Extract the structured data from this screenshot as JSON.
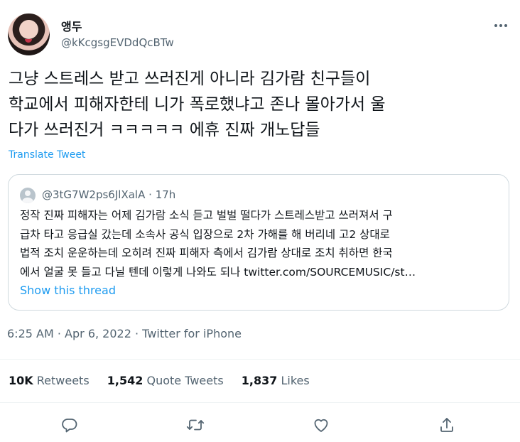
{
  "author": {
    "display_name": "앵두",
    "handle": "@kKcgsgEVDdQcBTw"
  },
  "tweet": {
    "lines": [
      "그냥 스트레스 받고 쓰러진게 아니라 김가람 친구들이",
      "학교에서 피해자한테 니가 폭로했냐고 존나 몰아가서 울",
      "다가 쓰러진거 ㅋㅋㅋㅋㅋ 에휴 진짜 개노답들"
    ],
    "translate_label": "Translate Tweet"
  },
  "quote": {
    "handle": "@3tG7W2ps6JlXalA",
    "separator": "·",
    "time": "17h",
    "lines": [
      "정작 진짜 피해자는 어제 김가람 소식 듣고 벌벌 떨다가 스트레스받고 쓰러져서 구",
      "급차 타고 응급실 갔는데 소속사 공식 입장으로 2차 가해를 해 버리네 고2 상대로",
      "법적 조치 운운하는데 오히려 진짜 피해자 측에서 김가람 상대로 조치 취하면 한국",
      "에서 얼굴 못 들고 다닐 텐데 이렇게 나와도 되나 twitter.com/SOURCEMUSIC/st…"
    ],
    "show_thread": "Show this thread"
  },
  "meta": {
    "time": "6:25 AM",
    "dot1": "·",
    "date": "Apr 6, 2022",
    "dot2": "·",
    "source": "Twitter for iPhone"
  },
  "stats": {
    "retweets_count": "10K",
    "retweets_label": "Retweets",
    "quotes_count": "1,542",
    "quotes_label": "Quote Tweets",
    "likes_count": "1,837",
    "likes_label": "Likes"
  },
  "icons": {
    "more": "more-horizontal-icon",
    "reply": "reply-icon",
    "retweet": "retweet-icon",
    "like": "heart-icon",
    "share": "share-icon"
  },
  "colors": {
    "accent": "#1d9bf0",
    "secondary_text": "#536471",
    "primary_text": "#0f1419",
    "border": "#cfd9de"
  }
}
